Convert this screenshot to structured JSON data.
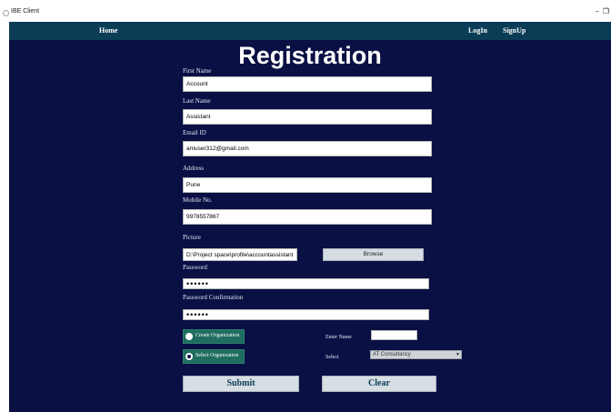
{
  "window": {
    "title": "IBE Client",
    "controls": [
      "–",
      "❐"
    ]
  },
  "nav": {
    "home": "Home",
    "login": "LogIn",
    "signup": "SignUp"
  },
  "form": {
    "heading": "Registration",
    "first_name": {
      "label": "First Name",
      "value": "Account"
    },
    "last_name": {
      "label": "Last Name",
      "value": "Assistant"
    },
    "email": {
      "label": "Email ID",
      "value": "amuser312@gmail.com"
    },
    "address": {
      "label": "Address",
      "value": "Pune"
    },
    "mobile": {
      "label": "Mobile No.",
      "value": "9978557867"
    },
    "picture": {
      "label": "Picture",
      "value": "D:\\Project space\\profile\\accountassistant.jpg",
      "browse_label": "Browse"
    },
    "password": {
      "label": "Password",
      "value": "••••••"
    },
    "password_confirm": {
      "label": "Password Confirmation",
      "value": "••••••"
    },
    "create_org": {
      "label": "Create Organization",
      "selected": false
    },
    "select_org": {
      "label": "Select Organization",
      "selected": true
    },
    "enter_name_label": "Enter Name",
    "enter_name_value": "",
    "select_label": "Select",
    "select_value": "AT Consultancy",
    "submit_label": "Submit",
    "clear_label": "Clear"
  },
  "colors": {
    "navbar": "#0b3d56",
    "background": "#0a0f44",
    "radio_box": "#1f6d5e",
    "button": "#d6dde3"
  }
}
